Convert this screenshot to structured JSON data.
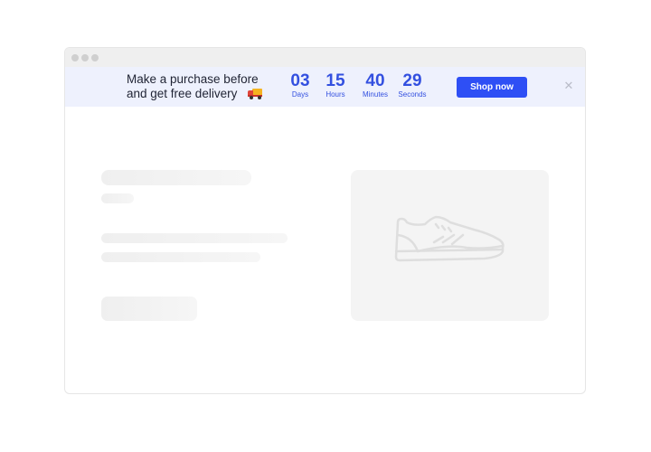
{
  "window": {
    "controls": [
      "window-dot-1",
      "window-dot-2",
      "window-dot-3"
    ]
  },
  "banner": {
    "message_line1": "Make a purchase before",
    "message_line2": "and get free delivery",
    "message_icon": "delivery-truck-icon",
    "countdown": [
      {
        "value": "03",
        "label": "Days"
      },
      {
        "value": "15",
        "label": "Hours"
      },
      {
        "value": "40",
        "label": "Minutes"
      },
      {
        "value": "29",
        "label": "Seconds"
      }
    ],
    "cta_label": "Shop now",
    "close_glyph": "✕",
    "accent_color": "#2e4ff5",
    "countdown_color": "#3350e0",
    "background_color": "#eef1fd"
  },
  "content": {
    "media_icon": "sneaker-icon",
    "placeholders": [
      "title-skeleton",
      "subtitle-skeleton",
      "text-line-skeleton-1",
      "text-line-skeleton-2",
      "button-skeleton"
    ]
  }
}
